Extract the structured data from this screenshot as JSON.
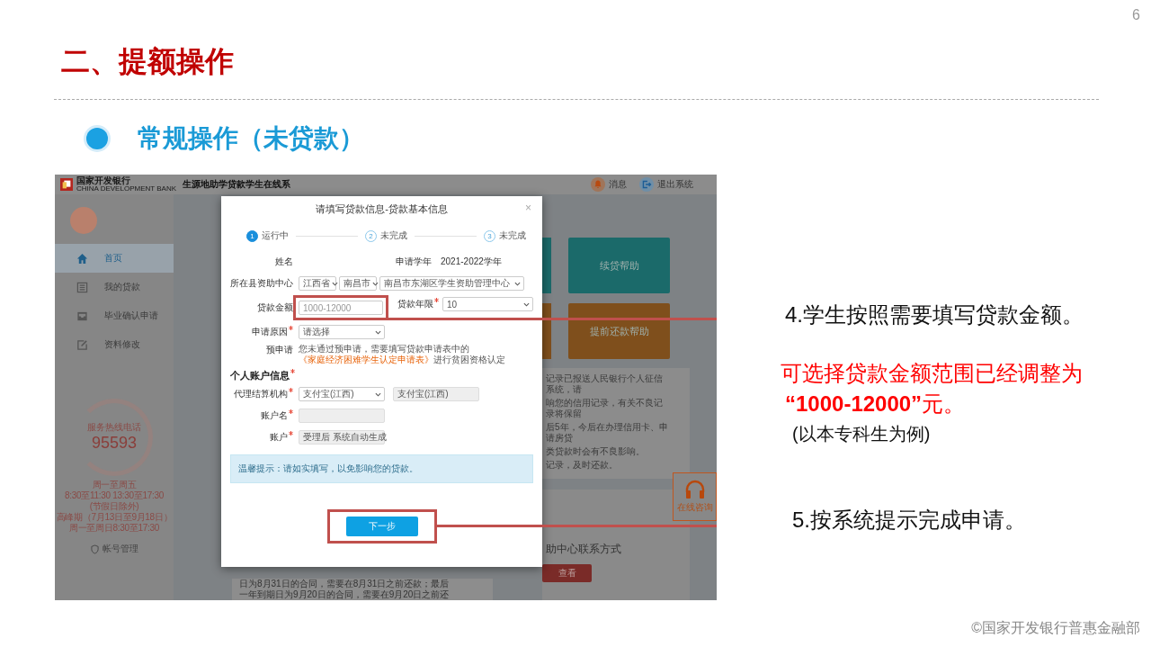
{
  "page_number": "6",
  "title": "二、提额操作",
  "subtitle": "常规操作（未贷款）",
  "app": {
    "header": {
      "bank_name": "国家开发银行",
      "bank_name_en": "CHINA DEVELOPMENT BANK",
      "system_name": "生源地助学贷款学生在线系",
      "actions": [
        {
          "kind": "bell",
          "label": "消息"
        },
        {
          "kind": "logout",
          "label": "退出系统"
        }
      ]
    },
    "sidebar": {
      "items": [
        {
          "kind": "home",
          "label": "首页",
          "selected": true
        },
        {
          "kind": "list",
          "label": "我的贷款",
          "selected": false
        },
        {
          "kind": "tray",
          "label": "毕业确认申请",
          "selected": false
        },
        {
          "kind": "edit",
          "label": "资料修改",
          "selected": false
        }
      ],
      "hotline": {
        "title": "服务热线电话",
        "number": "95593",
        "hours": [
          "周一至周五",
          "8:30至11:30 13:30至17:30",
          "(节假日除外)",
          "高峰期（7月13日至9月18日）",
          "周一至周日8:30至17:30"
        ]
      },
      "account": "帐号管理"
    },
    "tiles": [
      {
        "label": "续贷帮助",
        "color": "#1b6a6a"
      },
      {
        "label": "提前还款帮助",
        "color": "#7f4f1c"
      }
    ],
    "credit_notice": [
      "记录已报送人民银行个人征信系统，请",
      "响您的信用记录，有关不良记录将保留",
      "后5年，今后在办理信用卡、申请房贷",
      "类贷款时会有不良影响。",
      "记录，及时还款。"
    ],
    "contact": {
      "title": "助中心联系方式",
      "button": "查看"
    },
    "repay_notice": [
      "日为8月31日的合同，需要在8月31日之前还款；最后",
      "一年到期日为9月20日的合同，需要在9月20日之前还"
    ],
    "online_help": "在线咨询",
    "dialog": {
      "title": "请填写贷款信息-贷款基本信息",
      "close": "×",
      "steps": [
        {
          "number": "1",
          "label": "运行中",
          "active": true
        },
        {
          "number": "2",
          "label": "未完成",
          "active": false
        },
        {
          "number": "3",
          "label": "未完成",
          "active": false
        }
      ],
      "name": {
        "label": "姓名"
      },
      "year": {
        "label": "申请学年",
        "value": "2021-2022学年"
      },
      "center": {
        "label": "所在县资助中心",
        "selects": [
          "江西省",
          "南昌市",
          "南昌市东湖区学生资助管理中心"
        ]
      },
      "amount": {
        "label": "贷款金额",
        "placeholder": "1000-12000"
      },
      "term": {
        "label": "贷款年限",
        "required": true,
        "value": "10"
      },
      "reason": {
        "label": "申请原因",
        "required": true,
        "value": "请选择"
      },
      "pre": {
        "label": "预申请",
        "text": "您未通过预申请，需要填写贷款申请表中的",
        "link": "《家庭经济困难学生认定申请表》",
        "after": "进行贫困资格认定"
      },
      "section": {
        "title": "个人账户信息",
        "required": true
      },
      "agency": {
        "label": "代理结算机构",
        "required": true,
        "value": "支付宝(江西)",
        "display": "支付宝(江西)"
      },
      "account_name": {
        "label": "账户名",
        "required": true
      },
      "account": {
        "label": "账户",
        "required": true,
        "value": "受理后 系统自动生成"
      },
      "tip": "温馨提示：请如实填写，以免影响您的贷款。",
      "next": "下一步"
    }
  },
  "notes": {
    "step_4": "4.学生按照需要填写贷款金额。",
    "range_note": "可选择贷款金额范围已经调整为",
    "range_value": "**“1000-12000”**元。",
    "example": "(以本专科生为例)",
    "step_5": "5.按系统提示完成申请。"
  },
  "footer": "©国家开发银行普惠金融部"
}
